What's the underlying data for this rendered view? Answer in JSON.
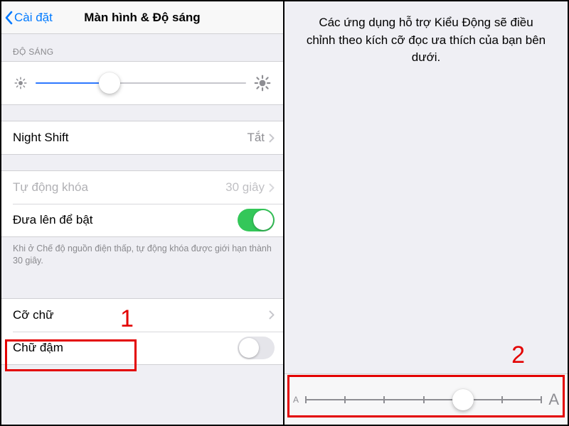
{
  "nav": {
    "back_label": "Cài đặt",
    "title": "Màn hình & Độ sáng"
  },
  "sections": {
    "brightness_header": "ĐỘ SÁNG",
    "brightness_percent": 35
  },
  "rows": {
    "night_shift": {
      "label": "Night Shift",
      "value": "Tắt"
    },
    "auto_lock": {
      "label": "Tự động khóa",
      "value": "30 giây"
    },
    "raise_to_wake": {
      "label": "Đưa lên để bật",
      "on": true
    },
    "text_size": {
      "label": "Cỡ chữ"
    },
    "bold_text": {
      "label": "Chữ đậm",
      "on": false
    }
  },
  "footnote": "Khi ở Chế độ nguồn điện thấp, tự động khóa được giới hạn thành 30 giây.",
  "right": {
    "description": "Các ứng dụng hỗ trợ Kiểu Động sẽ điều chỉnh theo kích cỡ đọc ưa thích của bạn bên dưới.",
    "small_letter": "A",
    "large_letter": "A",
    "steps": 7,
    "selected_step": 4
  },
  "annotations": {
    "num1": "1",
    "num2": "2"
  }
}
